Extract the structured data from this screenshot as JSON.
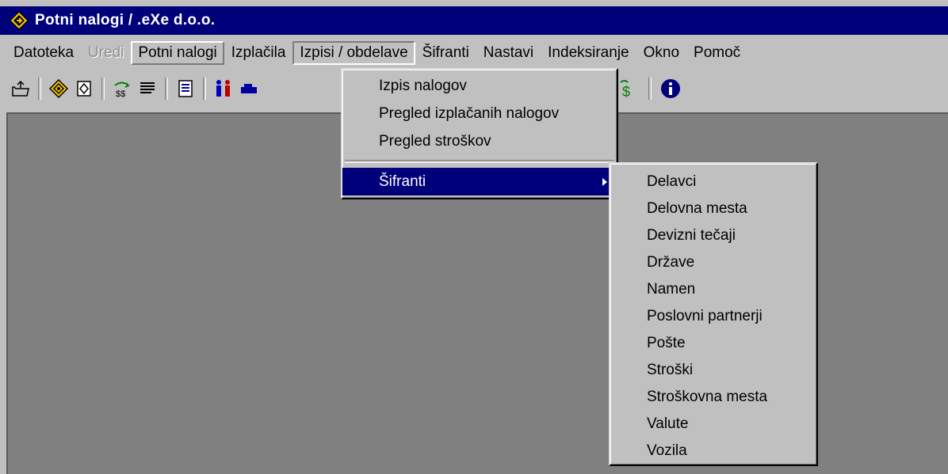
{
  "window": {
    "title": "Potni nalogi / .eXe d.o.o.",
    "title_bar_color": "#00007b",
    "icon": "app-diamond-icon"
  },
  "menubar": {
    "items": [
      {
        "label": "Datoteka",
        "state": "normal"
      },
      {
        "label": "Uredi",
        "state": "disabled"
      },
      {
        "label": "Potni nalogi",
        "state": "raised"
      },
      {
        "label": "Izplačila",
        "state": "normal"
      },
      {
        "label": "Izpisi / obdelave",
        "state": "open"
      },
      {
        "label": "Šifranti",
        "state": "normal"
      },
      {
        "label": "Nastavi",
        "state": "normal"
      },
      {
        "label": "Indeksiranje",
        "state": "normal"
      },
      {
        "label": "Okno",
        "state": "normal"
      },
      {
        "label": "Pomoč",
        "state": "normal"
      }
    ]
  },
  "toolbar": {
    "buttons": [
      {
        "icon": "open-folder-icon"
      },
      {
        "icon": "road-sign-icon"
      },
      {
        "icon": "form-icon"
      },
      {
        "icon": "transfer-icon"
      },
      {
        "icon": "list-icon"
      },
      {
        "icon": "document-icon"
      },
      {
        "icon": "people-icon"
      },
      {
        "icon": "car-icon"
      },
      {
        "icon": "currency-icon"
      },
      {
        "icon": "info-icon"
      }
    ]
  },
  "dropdown": {
    "items": [
      "Izpis nalogov",
      "Pregled izplačanih nalogov",
      "Pregled stroškov"
    ],
    "submenu_label": "Šifranti"
  },
  "submenu": {
    "items": [
      "Delavci",
      "Delovna mesta",
      "Devizni tečaji",
      "Države",
      "Namen",
      "Poslovni partnerji",
      "Pošte",
      "Stroški",
      "Stroškovna mesta",
      "Valute",
      "Vozila"
    ]
  },
  "colors": {
    "selection": "#00007b",
    "face": "#c0c0c0",
    "workspace": "#808080"
  }
}
